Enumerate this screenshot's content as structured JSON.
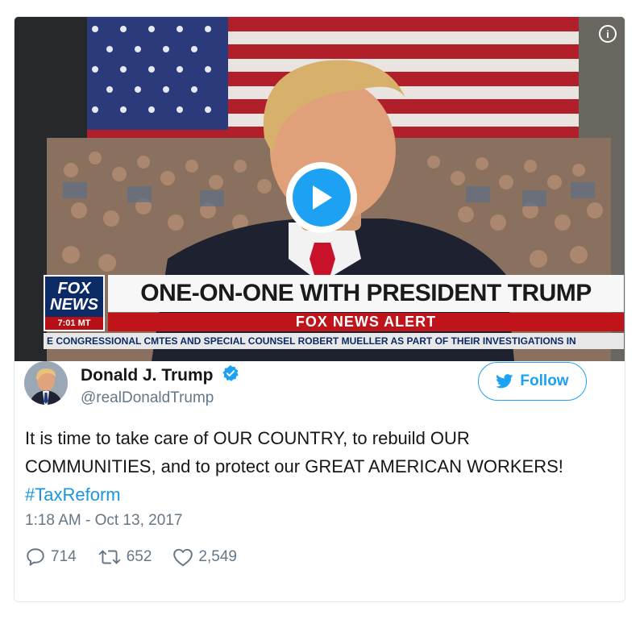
{
  "video": {
    "info_glyph": "i",
    "chyron": {
      "logo_line1": "FOX",
      "logo_line2": "NEWS",
      "time": "7:01 MT",
      "headline": "ONE-ON-ONE WITH PRESIDENT TRUMP",
      "alert": "FOX NEWS ALERT",
      "ticker": "E CONGRESSIONAL CMTES AND SPECIAL COUNSEL ROBERT MUELLER AS PART OF THEIR INVESTIGATIONS IN"
    }
  },
  "author": {
    "name": "Donald J. Trump",
    "handle": "@realDonaldTrump",
    "verified": true
  },
  "follow": {
    "label": "Follow"
  },
  "tweet": {
    "text": "It is time to take care of OUR COUNTRY, to rebuild OUR COMMUNITIES, and to protect our GREAT AMERICAN WORKERS!",
    "hashtag": "#TaxReform",
    "timestamp": "1:18 AM - Oct 13, 2017"
  },
  "stats": {
    "replies": "714",
    "retweets": "652",
    "likes": "2,549"
  },
  "icons": [
    "info-icon",
    "play-icon",
    "verified-badge-icon",
    "twitter-bird-icon",
    "reply-icon",
    "retweet-icon",
    "heart-icon"
  ],
  "colors": {
    "accent": "#1da1f2",
    "hashtag": "#1b95e0",
    "muted": "#657786",
    "fox_red": "#c0141b",
    "fox_blue": "#0c2a66"
  }
}
